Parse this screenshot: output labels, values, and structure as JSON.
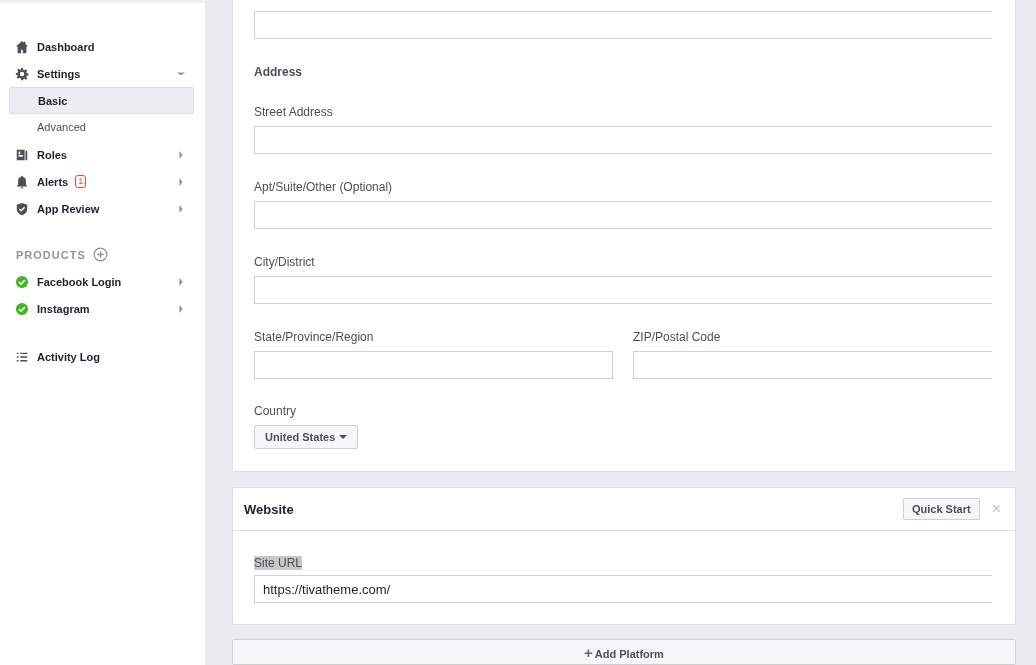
{
  "sidebar": {
    "items": [
      {
        "label": "Dashboard",
        "selected": false
      },
      {
        "label": "Settings",
        "expanded": true,
        "selected": false,
        "children": [
          {
            "label": "Basic",
            "selected": true
          },
          {
            "label": "Advanced",
            "selected": false
          }
        ]
      },
      {
        "label": "Roles",
        "expanded": false,
        "selected": false
      },
      {
        "label": "Alerts",
        "badge": "1",
        "expanded": false,
        "selected": false
      },
      {
        "label": "App Review",
        "expanded": false,
        "selected": false
      }
    ],
    "products_heading": "PRODUCTS",
    "products": [
      {
        "label": "Facebook Login",
        "expanded": false,
        "selected": false
      },
      {
        "label": "Instagram",
        "expanded": false,
        "selected": false
      }
    ],
    "footer_items": [
      {
        "label": "Activity Log",
        "selected": false
      }
    ]
  },
  "address": {
    "heading": "Address",
    "street_label": "Street Address",
    "apt_label": "Apt/Suite/Other (Optional)",
    "city_label": "City/District",
    "state_label": "State/Province/Region",
    "zip_label": "ZIP/Postal Code",
    "country_label": "Country",
    "country_value": "United States"
  },
  "website": {
    "title": "Website",
    "quick_start": "Quick Start",
    "close": "×",
    "site_url_label": "Site URL",
    "site_url_value": "https://tivatheme.com/"
  },
  "add_platform": {
    "icon": "+",
    "label": "Add Platform"
  }
}
